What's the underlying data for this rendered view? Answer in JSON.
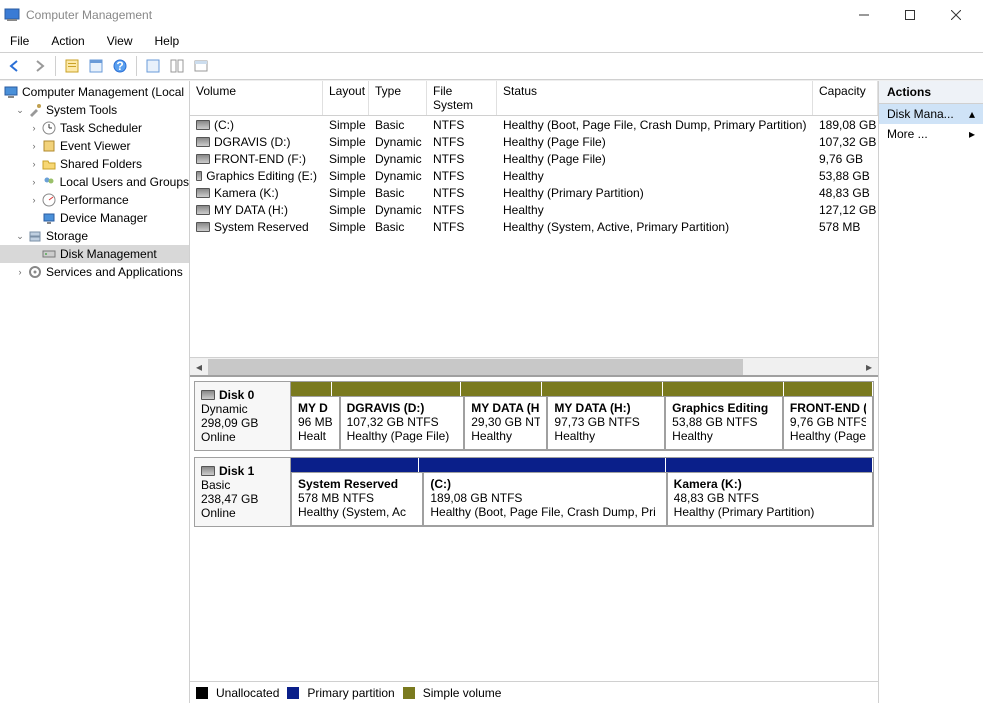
{
  "window": {
    "title": "Computer Management"
  },
  "menu": {
    "file": "File",
    "action": "Action",
    "view": "View",
    "help": "Help"
  },
  "tree": {
    "root": "Computer Management (Local",
    "system_tools": "System Tools",
    "task_scheduler": "Task Scheduler",
    "event_viewer": "Event Viewer",
    "shared_folders": "Shared Folders",
    "local_users": "Local Users and Groups",
    "performance": "Performance",
    "device_manager": "Device Manager",
    "storage": "Storage",
    "disk_management": "Disk Management",
    "services": "Services and Applications"
  },
  "columns": {
    "volume": "Volume",
    "layout": "Layout",
    "type": "Type",
    "fs": "File System",
    "status": "Status",
    "capacity": "Capacity"
  },
  "volumes": [
    {
      "name": "(C:)",
      "layout": "Simple",
      "type": "Basic",
      "fs": "NTFS",
      "status": "Healthy (Boot, Page File, Crash Dump, Primary Partition)",
      "capacity": "189,08 GB"
    },
    {
      "name": "DGRAVIS (D:)",
      "layout": "Simple",
      "type": "Dynamic",
      "fs": "NTFS",
      "status": "Healthy (Page File)",
      "capacity": "107,32 GB"
    },
    {
      "name": "FRONT-END (F:)",
      "layout": "Simple",
      "type": "Dynamic",
      "fs": "NTFS",
      "status": "Healthy (Page File)",
      "capacity": "9,76 GB"
    },
    {
      "name": "Graphics Editing (E:)",
      "layout": "Simple",
      "type": "Dynamic",
      "fs": "NTFS",
      "status": "Healthy",
      "capacity": "53,88 GB"
    },
    {
      "name": "Kamera (K:)",
      "layout": "Simple",
      "type": "Basic",
      "fs": "NTFS",
      "status": "Healthy (Primary Partition)",
      "capacity": "48,83 GB"
    },
    {
      "name": "MY DATA (H:)",
      "layout": "Simple",
      "type": "Dynamic",
      "fs": "NTFS",
      "status": "Healthy",
      "capacity": "127,12 GB"
    },
    {
      "name": "System Reserved",
      "layout": "Simple",
      "type": "Basic",
      "fs": "NTFS",
      "status": "Healthy (System, Active, Primary Partition)",
      "capacity": "578 MB"
    }
  ],
  "disks": [
    {
      "label": "Disk 0",
      "kind": "Dynamic",
      "size": "298,09 GB",
      "state": "Online",
      "parts": [
        {
          "name": "MY D",
          "line1": "96 MB",
          "line2": "Healt",
          "flex": 5
        },
        {
          "name": "DGRAVIS  (D:)",
          "line1": "107,32 GB NTFS",
          "line2": "Healthy (Page File)",
          "flex": 16
        },
        {
          "name": "MY DATA  (H:)",
          "line1": "29,30 GB NTFS",
          "line2": "Healthy",
          "flex": 10
        },
        {
          "name": "MY DATA  (H:)",
          "line1": "97,73 GB NTFS",
          "line2": "Healthy",
          "flex": 15
        },
        {
          "name": "Graphics Editing",
          "line1": "53,88 GB NTFS",
          "line2": "Healthy",
          "flex": 15
        },
        {
          "name": "FRONT-END  (",
          "line1": "9,76 GB NTFS",
          "line2": "Healthy (Page",
          "flex": 11
        }
      ],
      "stripe_color": "olive"
    },
    {
      "label": "Disk 1",
      "kind": "Basic",
      "size": "238,47 GB",
      "state": "Online",
      "parts": [
        {
          "name": "System Reserved",
          "line1": "578 MB NTFS",
          "line2": "Healthy (System, Ac",
          "flex": 16
        },
        {
          "name": "(C:)",
          "line1": "189,08 GB NTFS",
          "line2": "Healthy (Boot, Page File, Crash Dump, Pri",
          "flex": 31
        },
        {
          "name": "Kamera  (K:)",
          "line1": "48,83 GB NTFS",
          "line2": "Healthy (Primary Partition)",
          "flex": 26
        }
      ],
      "stripe_color": "navy"
    }
  ],
  "legend": {
    "unallocated": "Unallocated",
    "primary": "Primary partition",
    "simple": "Simple volume"
  },
  "actions": {
    "header": "Actions",
    "disk_mgmt": "Disk Mana...",
    "more": "More ..."
  }
}
